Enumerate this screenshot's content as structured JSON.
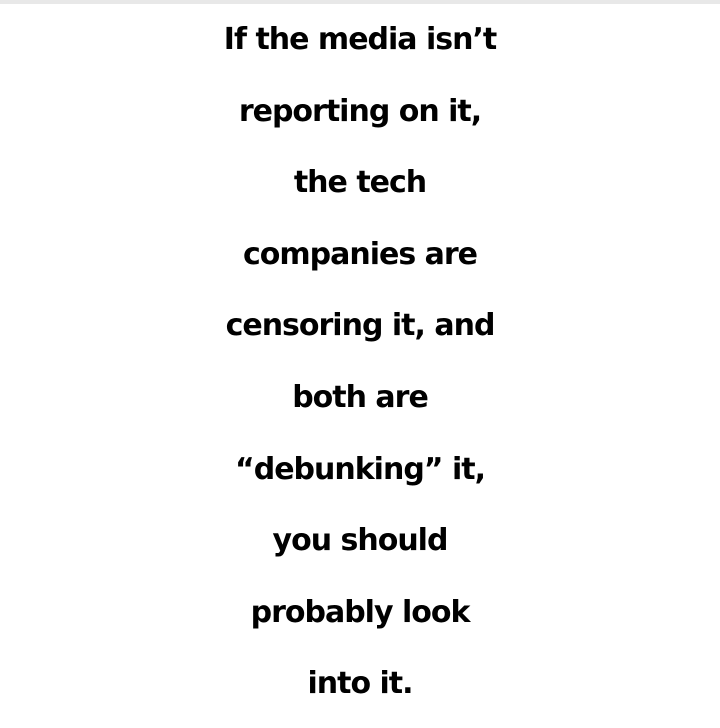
{
  "colors": {
    "background": "#ffffff",
    "text": "#000000"
  },
  "quote": {
    "lines": [
      "If the media isn’t",
      "reporting on it,",
      "the tech",
      "companies are",
      "censoring it, and",
      "both are",
      "“debunking” it,",
      "you should",
      "probably look",
      "into it."
    ]
  }
}
